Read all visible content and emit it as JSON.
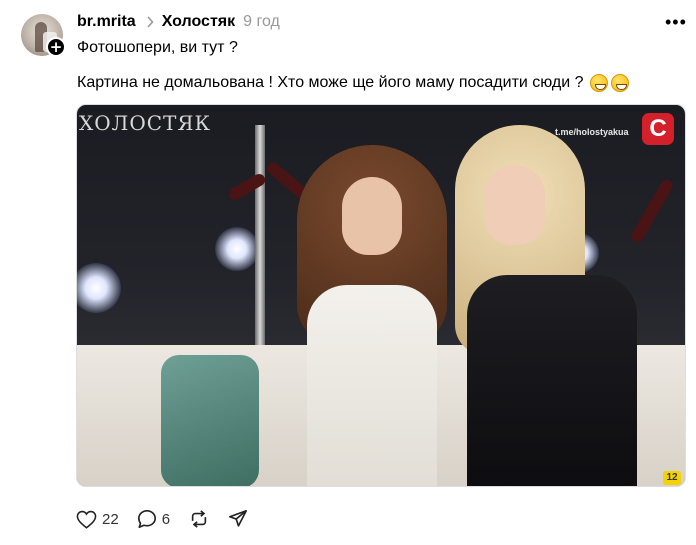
{
  "post": {
    "username": "br.mrita",
    "community": "Холостяк",
    "time": "9 год",
    "text_line1": "Фотошопери, ви тут ?",
    "text_line2": "Картина не домальована ! Хто може ще його маму посадити сюди ?"
  },
  "image": {
    "show_logo": "ХОЛОСТЯК",
    "url_overlay": "t.me/holostyakua",
    "channel_logo": "С",
    "age_rating": "12"
  },
  "actions": {
    "likes": "22",
    "comments": "6"
  },
  "icons": {
    "more": "more-horizontal-icon",
    "chevron": "chevron-right-icon",
    "follow": "plus-icon",
    "like": "heart-icon",
    "comment": "comment-icon",
    "repost": "repost-icon",
    "share": "send-icon"
  }
}
